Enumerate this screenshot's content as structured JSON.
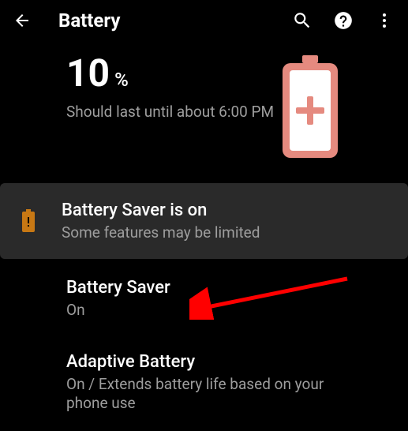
{
  "header": {
    "title": "Battery"
  },
  "battery": {
    "percent": "10",
    "percent_sign": "%",
    "estimate": "Should last until about 6:00 PM"
  },
  "notice": {
    "title": "Battery Saver is on",
    "subtitle": "Some features may be limited"
  },
  "items": [
    {
      "title": "Battery Saver",
      "subtitle": "On"
    },
    {
      "title": "Adaptive Battery",
      "subtitle": "On / Extends battery life based on your phone use"
    }
  ],
  "colors": {
    "accent": "#e58a7f",
    "saver_icon": "#c77814"
  }
}
